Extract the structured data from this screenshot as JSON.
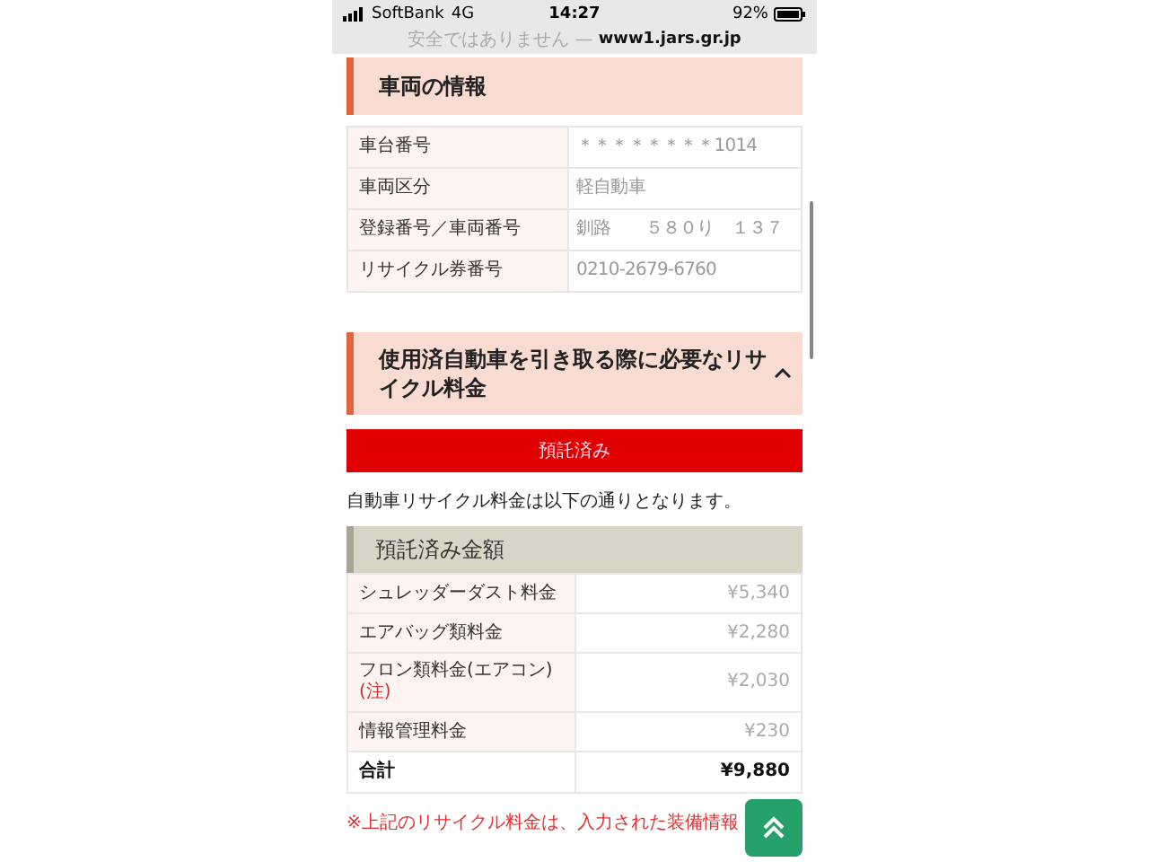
{
  "status_bar": {
    "carrier": "SoftBank",
    "network": "4G",
    "time": "14:27",
    "battery": "92%",
    "security": "安全ではありません —",
    "url": "www1.jars.gr.jp"
  },
  "vehicle_section": {
    "title": "車両の情報",
    "rows": [
      {
        "label": "車台番号",
        "value": "＊＊＊＊＊＊＊＊1014"
      },
      {
        "label": "車両区分",
        "value": "軽自動車"
      },
      {
        "label": "登録番号／車両番号",
        "value": "釧路　　５８０り　１３７"
      },
      {
        "label": "リサイクル券番号",
        "value": "0210-2679-6760"
      }
    ]
  },
  "fee_section": {
    "title": "使用済自動車を引き取る際に必要なリサイクル料金",
    "expanded": true,
    "status_button": "預託済み",
    "intro": "自動車リサイクル料金は以下の通りとなります。",
    "deposit_table": {
      "title": "預託済み金額",
      "rows": [
        {
          "kind": "item",
          "label": "シュレッダーダスト料金",
          "value": "¥5,340"
        },
        {
          "kind": "item",
          "label": "エアバッグ類料金",
          "value": "¥2,280"
        },
        {
          "kind": "item",
          "label": "フロン類料金(エアコン)",
          "note": "(注)",
          "value": "¥2,030"
        },
        {
          "kind": "item",
          "label": "情報管理料金",
          "value": "¥230"
        },
        {
          "kind": "total",
          "label": "合計",
          "value": "¥9,880"
        }
      ]
    },
    "note": "※上記のリサイクル料金は、入力された装備情報"
  }
}
